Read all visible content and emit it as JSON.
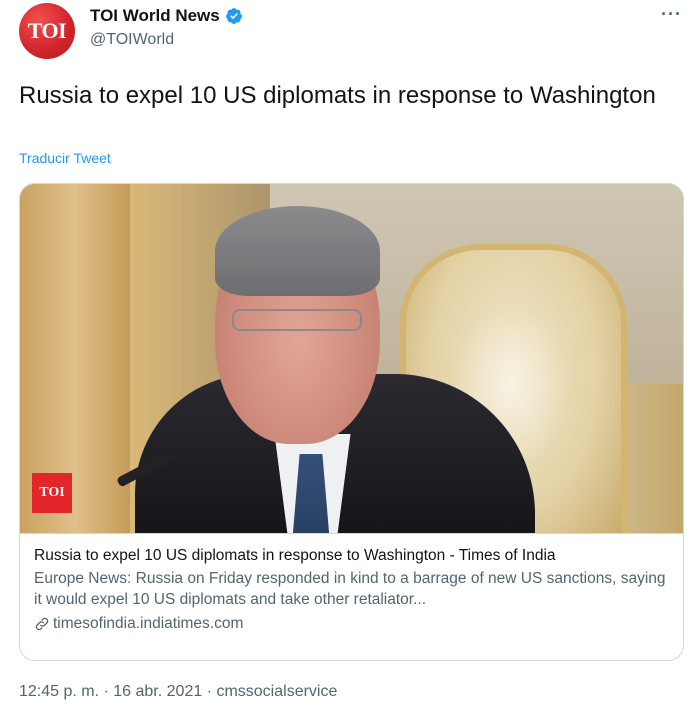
{
  "account": {
    "avatar_text": "TOI",
    "display_name": "TOI World News",
    "handle": "@TOIWorld",
    "verified": true
  },
  "icons": {
    "verified": "verified-badge-icon",
    "more": "more-options-icon",
    "link": "link-icon"
  },
  "tweet": {
    "text": "Russia to expel 10 US diplomats in response to Washington",
    "translate_label": "Traducir Tweet"
  },
  "card": {
    "image_badge": "TOI",
    "title": "Russia to expel 10 US diplomats in response to Washington - Times of India",
    "description": "Europe News: Russia on Friday responded in kind to a barrage of new US sanctions, saying it would expel 10 US diplomats and take other retaliator...",
    "domain": "timesofindia.indiatimes.com"
  },
  "meta": {
    "time": "12:45 p. m.",
    "separator": " · ",
    "date": "16 abr. 2021",
    "source": "cmssocialservice"
  },
  "colors": {
    "accent": "#1d9bf0",
    "secondary_text": "#536471",
    "brand_red": "#e3262a"
  }
}
